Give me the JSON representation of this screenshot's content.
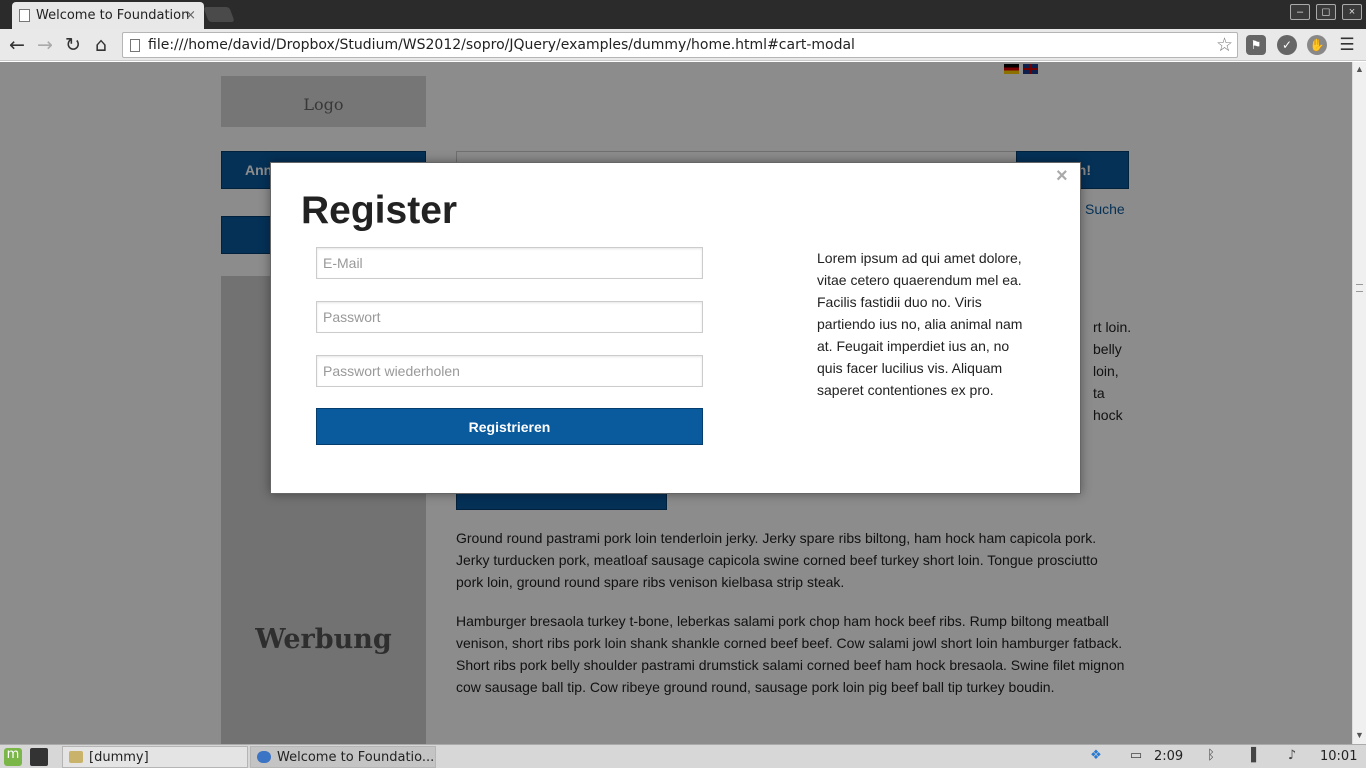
{
  "browser": {
    "tab_title": "Welcome to Foundation",
    "tab_close": "×",
    "url": "file:///home/david/Dropbox/Studium/WS2012/sopro/JQuery/examples/dummy/home.html#cart-modal",
    "win_minimize": "–",
    "win_maximize": "◻",
    "win_close": "×"
  },
  "page": {
    "logo": "Logo",
    "nav_button_partial": "Ann",
    "search_button_partial": "en!",
    "search_link_partial": "Suche",
    "ad_label": "Werbung",
    "right_fragments": [
      "rt loin.",
      "belly",
      "loin,",
      "ta",
      "hock"
    ],
    "paragraphs": [
      "Ground round pastrami pork loin tenderloin jerky. Jerky spare ribs biltong, ham hock ham capicola pork. Jerky turducken pork, meatloaf sausage capicola swine corned beef turkey short loin. Tongue prosciutto pork loin, ground round spare ribs venison kielbasa strip steak.",
      "Hamburger bresaola turkey t-bone, leberkas salami pork chop ham hock beef ribs. Rump biltong meatball venison, short ribs pork loin shank shankle corned beef beef. Cow salami jowl short loin hamburger fatback. Short ribs pork belly shoulder pastrami drumstick salami corned beef ham hock bresaola. Swine filet mignon cow sausage ball tip. Cow ribeye ground round, sausage pork loin pig beef ball tip turkey boudin."
    ]
  },
  "modal": {
    "close": "×",
    "title": "Register",
    "email_placeholder": "E-Mail",
    "password_placeholder": "Passwort",
    "password_repeat_placeholder": "Passwort wiederholen",
    "submit_label": "Registrieren",
    "info_text": "Lorem ipsum ad qui amet dolore, vitae cetero quaerendum mel ea. Facilis fastidii duo no. Viris partiendo ius no, alia animal nam at. Feugait imperdiet ius an, no quis facer lucilius vis. Aliquam saperet contentiones ex pro."
  },
  "taskbar": {
    "items": [
      "[dummy]",
      "Welcome to Foundatio..."
    ],
    "battery_time": "2:09",
    "clock": "10:01"
  },
  "colors": {
    "accent": "#0a5a9e",
    "overlay": "rgba(0,0,0,0.45)"
  }
}
